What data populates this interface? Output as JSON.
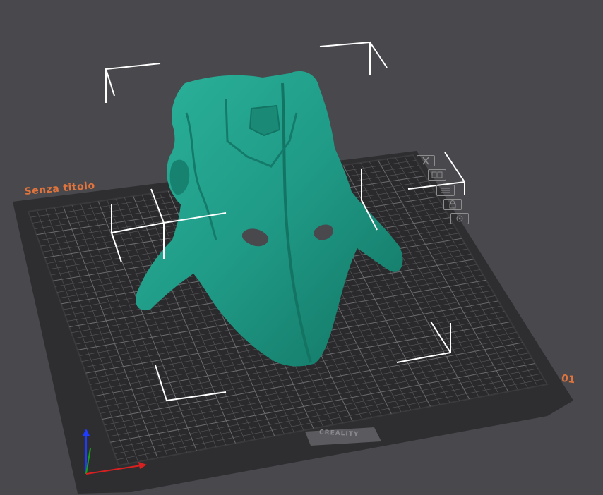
{
  "plate": {
    "name": "Senza titolo",
    "number": "01",
    "brand": "CREALITY"
  },
  "plate_tools": [
    {
      "icon": "close-icon"
    },
    {
      "icon": "arrange-icon"
    },
    {
      "icon": "settings-icon"
    },
    {
      "icon": "lock-icon"
    },
    {
      "icon": "orient-icon"
    }
  ],
  "colors": {
    "background": "#48484d",
    "bed": "#2a2a2c",
    "grid": "#5a5a5e",
    "model": "#1f9a86",
    "accent": "#e0743c",
    "selection": "#ffffff"
  }
}
